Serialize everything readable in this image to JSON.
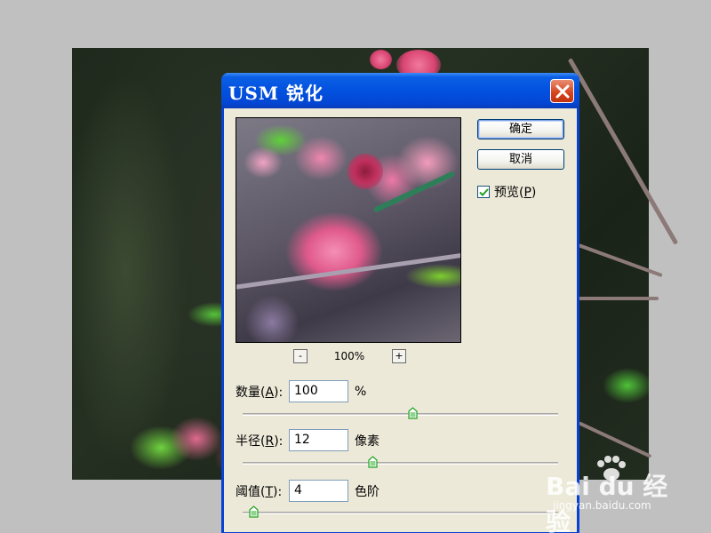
{
  "dialog": {
    "title": "USM 锐化",
    "ok_label": "确定",
    "cancel_label": "取消",
    "preview": {
      "label_prefix": "预览(",
      "label_key": "P",
      "label_suffix": ")",
      "checked": true
    },
    "zoom": {
      "minus": "-",
      "plus": "+",
      "value": "100%"
    },
    "amount": {
      "label_prefix": "数量(",
      "label_key": "A",
      "label_suffix": "):",
      "value": "100",
      "unit": "%",
      "slider_fraction": 0.54
    },
    "radius": {
      "label_prefix": "半径(",
      "label_key": "R",
      "label_suffix": "):",
      "value": "12",
      "unit": "像素",
      "slider_fraction": 0.41
    },
    "threshold": {
      "label_prefix": "阈值(",
      "label_key": "T",
      "label_suffix": "):",
      "value": "4",
      "unit": "色阶",
      "slider_fraction": 0.02
    }
  },
  "watermark": {
    "brand": "Bai du 经验",
    "url": "jingyan.baidu.com"
  },
  "colors": {
    "titlebar": "#0351df",
    "dialog_bg": "#ece9d8",
    "close_button": "#d5411a",
    "checkmark": "#21a121",
    "slider_thumb": "#21a121"
  }
}
